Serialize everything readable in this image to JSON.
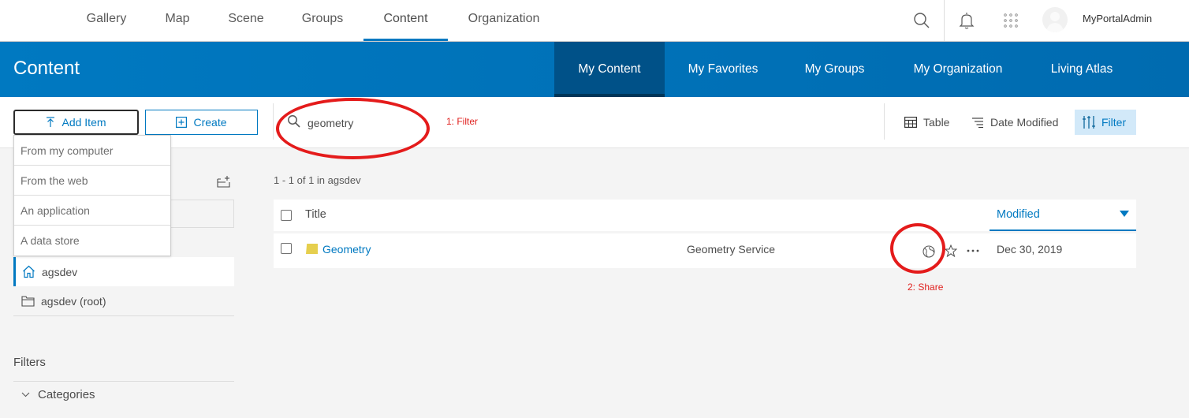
{
  "topnav": {
    "links": [
      {
        "label": "Gallery"
      },
      {
        "label": "Map"
      },
      {
        "label": "Scene"
      },
      {
        "label": "Groups"
      },
      {
        "label": "Content",
        "active": true
      },
      {
        "label": "Organization"
      }
    ],
    "icons": [
      "search-icon",
      "bell-icon",
      "app-launcher-icon"
    ],
    "username": "MyPortalAdmin"
  },
  "header": {
    "title": "Content",
    "tabs": [
      {
        "label": "My Content",
        "active": true
      },
      {
        "label": "My Favorites"
      },
      {
        "label": "My Groups"
      },
      {
        "label": "My Organization"
      },
      {
        "label": "Living Atlas"
      }
    ]
  },
  "toolbar": {
    "add_item_label": "Add Item",
    "create_label": "Create",
    "search_value": "geometry",
    "view_label": "Table",
    "sort_label": "Date Modified",
    "filter_label": "Filter"
  },
  "add_item_menu": [
    {
      "label": "From my computer"
    },
    {
      "label": "From the web"
    },
    {
      "label": "An application"
    },
    {
      "label": "A data store"
    }
  ],
  "sidebar": {
    "folders": [
      {
        "label": "agsdev",
        "icon": "home-icon",
        "active": true
      },
      {
        "label": "agsdev (root)",
        "icon": "folder-icon"
      }
    ],
    "filters_title": "Filters",
    "categories_label": "Categories"
  },
  "results": {
    "count_text": "1 - 1 of 1 in agsdev",
    "columns": {
      "title": "Title",
      "modified": "Modified"
    },
    "rows": [
      {
        "title": "Geometry",
        "type": "Geometry Service",
        "modified": "Dec 30, 2019"
      }
    ]
  },
  "annotations": {
    "filter": "1: Filter",
    "share": "2:  Share"
  },
  "colors": {
    "brand": "#0079c1",
    "annotation": "#e41b1b"
  }
}
